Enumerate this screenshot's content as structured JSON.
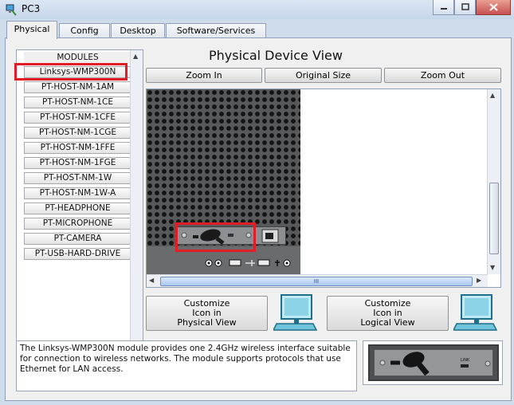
{
  "window": {
    "title": "PC3"
  },
  "tabs": [
    {
      "label": "Physical",
      "active": true
    },
    {
      "label": "Config"
    },
    {
      "label": "Desktop"
    },
    {
      "label": "Software/Services"
    }
  ],
  "modules": {
    "header": "MODULES",
    "items": [
      "Linksys-WMP300N",
      "PT-HOST-NM-1AM",
      "PT-HOST-NM-1CE",
      "PT-HOST-NM-1CFE",
      "PT-HOST-NM-1CGE",
      "PT-HOST-NM-1FFE",
      "PT-HOST-NM-1FGE",
      "PT-HOST-NM-1W",
      "PT-HOST-NM-1W-A",
      "PT-HEADPHONE",
      "PT-MICROPHONE",
      "PT-CAMERA",
      "PT-USB-HARD-DRIVE"
    ],
    "selected": "Linksys-WMP300N"
  },
  "view": {
    "title": "Physical Device View",
    "zoom_in": "Zoom In",
    "original_size": "Original Size",
    "zoom_out": "Zoom Out",
    "scroll_grip": "III"
  },
  "customize": {
    "physical": [
      "Customize",
      "Icon in",
      "Physical View"
    ],
    "logical": [
      "Customize",
      "Icon in",
      "Logical View"
    ]
  },
  "description": "The Linksys-WMP300N module provides one 2.4GHz wireless interface suitable for connection to wireless networks. The module supports protocols that use Ethernet for LAN access.",
  "thumbnail": {
    "port_label": "LINK"
  },
  "icons": [
    "pc-app-icon",
    "minimize-icon",
    "maximize-icon",
    "close-icon",
    "scroll-up-icon",
    "scroll-down-icon",
    "scroll-left-icon",
    "scroll-right-icon",
    "computer-icon",
    "antenna-icon"
  ],
  "colors": {
    "highlight": "#e31d25",
    "device": "#58595b"
  }
}
